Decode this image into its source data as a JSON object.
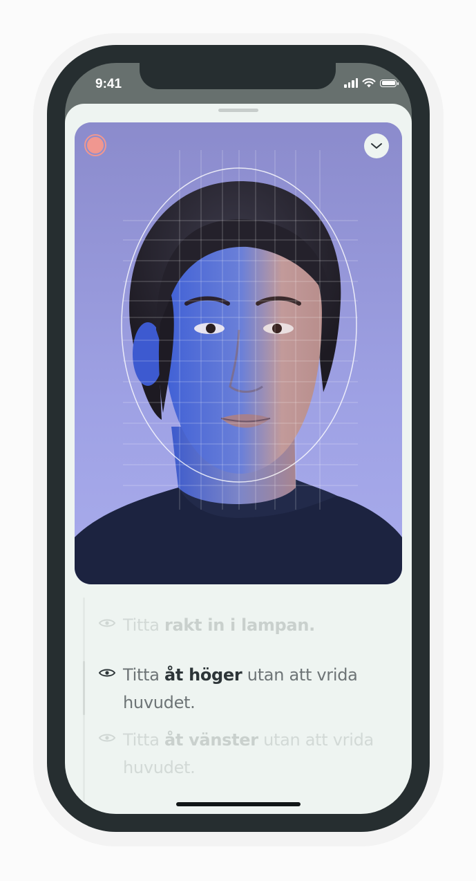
{
  "status_bar": {
    "time": "9:41"
  },
  "camera_view": {
    "record_button_color": "#f09790"
  },
  "instructions": [
    {
      "before": "Titta ",
      "bold": "rakt in i lampan.",
      "after": "",
      "line2": "",
      "state": "inactive"
    },
    {
      "before": "Titta ",
      "bold": "åt höger",
      "after": " utan att vrida",
      "line2": "huvudet.",
      "state": "active"
    },
    {
      "before": "Titta ",
      "bold": "åt vänster",
      "after": " utan att vrida",
      "line2": "huvudet.",
      "state": "inactive"
    }
  ],
  "colors": {
    "device_frame": "#262e30",
    "sheet_background": "#eef4f1",
    "active_text": "#2d3538",
    "inactive_text": "#d2d9d6"
  }
}
